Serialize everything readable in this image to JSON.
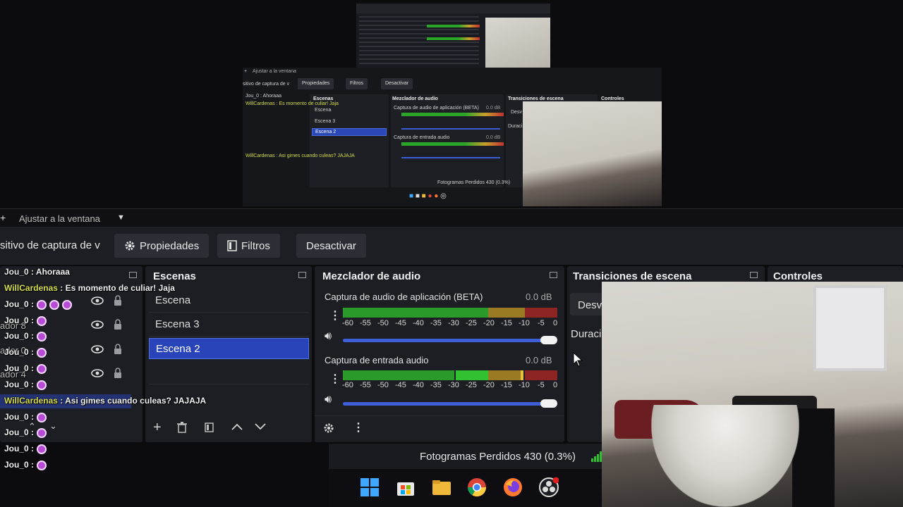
{
  "toolbar": {
    "plus": "+",
    "fit_label": "Ajustar a la ventana",
    "caret": "▼"
  },
  "context_bar": {
    "source_name": "sitivo de captura de v",
    "properties_label": "Propiedades",
    "filters_label": "Filtros",
    "deactivate_label": "Desactivar"
  },
  "docks": {
    "scenes_title": "Escenas",
    "mixer_title": "Mezclador de audio",
    "transitions_title": "Transiciones de escena",
    "controls_title": "Controles"
  },
  "scenes": [
    {
      "label": "Escena",
      "selected": false
    },
    {
      "label": "Escena 3",
      "selected": false
    },
    {
      "label": "Escena 2",
      "selected": true
    }
  ],
  "mixer": {
    "channels": [
      {
        "name": "Captura de audio de aplicación (BETA)",
        "db": "0.0 dB",
        "level": 0.0
      },
      {
        "name": "Captura de entrada audio",
        "db": "0.0 dB",
        "level": 0.0
      }
    ],
    "scale": [
      "-60",
      "-55",
      "-50",
      "-45",
      "-40",
      "-35",
      "-30",
      "-25",
      "-20",
      "-15",
      "-10",
      "-5",
      "0"
    ]
  },
  "transitions": {
    "item_label": "Desv",
    "duration_label": "Duraci"
  },
  "status": {
    "frames_dropped": "Fotogramas Perdidos 430 (0.3%)"
  },
  "chat": [
    {
      "user": "Jou_0",
      "text": "Ahoraaa"
    },
    {
      "user": "WillCardenas",
      "text": "Es momento de culiar! Jaja"
    },
    {
      "user": "Jou_0",
      "text": ""
    },
    {
      "user": "Jou_0",
      "text": ""
    },
    {
      "user": "Jou_0",
      "text": ""
    },
    {
      "user": "Jou_0",
      "text": ""
    },
    {
      "user": "Jou_0",
      "text": ""
    },
    {
      "user": "Jou_0",
      "text": ""
    },
    {
      "user": "WillCardenas",
      "text": "Asi gimes cuando culeas? JAJAJA"
    },
    {
      "user": "Jou_0",
      "text": ""
    },
    {
      "user": "Jou_0",
      "text": ""
    },
    {
      "user": "Jou_0",
      "text": ""
    },
    {
      "user": "Jou_0",
      "text": ""
    }
  ],
  "ghost_sources": [
    "ador 8",
    "ador 0",
    "ador 4"
  ],
  "mini_preview": {
    "fit_label": "Ajustar a la ventana",
    "source_name": "sitivo de captura de v",
    "properties_label": "Propiedades",
    "filters_label": "Filtros",
    "deactivate_label": "Desactivar",
    "scenes_title": "Escenas",
    "mixer_title": "Mezclador de audio",
    "transitions_title": "Transiciones de escena",
    "controls_title": "Controles",
    "scenes": [
      "Escena",
      "Escena 3",
      "Escena 2"
    ],
    "ch1": "Captura de audio de aplicación (BETA)",
    "ch2": "Captura de entrada audio",
    "db": "0.0 dB",
    "chat1": "Jou_0 : Ahoraaa",
    "chat2": "WillCardenas : Es momento de culiar! Jaja",
    "chat3": "WillCardenas : Asi gimes cuando culeas? JAJAJA",
    "frames": "Fotogramas Perdidos 430 (0.3%)",
    "duration": "Duraci",
    "desv": "Desv"
  },
  "colors": {
    "accent": "#2944b8",
    "meter_green": "#2aa52a",
    "meter_yellow": "#c7a02a",
    "meter_red": "#c03030",
    "slider": "#3f5fd8"
  }
}
